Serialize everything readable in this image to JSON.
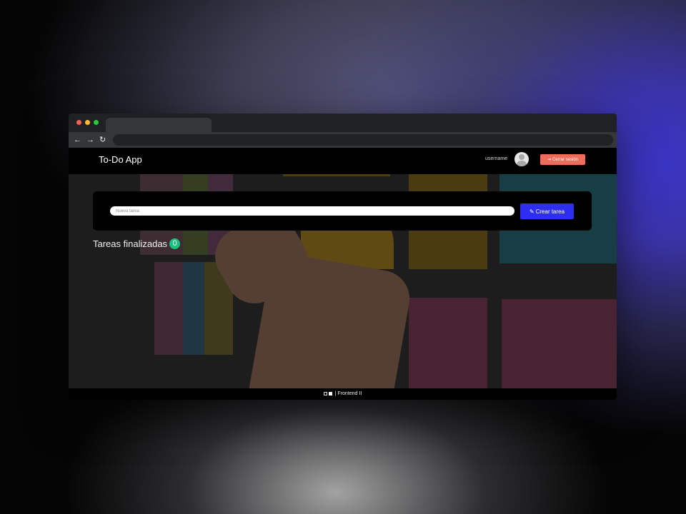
{
  "navbar": {
    "brand": "To-Do App",
    "username": "username",
    "logout_label": "Cerrar sesión"
  },
  "form": {
    "placeholder": "Nueva tarea",
    "button_label": "Crear tarea"
  },
  "tasks": {
    "done_title": "Tareas finalizadas",
    "done_count": "0"
  },
  "footer": {
    "text": "| Frontend II"
  },
  "icons": {
    "logout": "sign-out-icon",
    "create": "pencil-icon",
    "avatar": "user-avatar-icon"
  },
  "colors": {
    "logout_button": "#ef6c5a",
    "create_button": "#2e2ef0",
    "count_badge": "#19c37d",
    "navbar": "#000000"
  }
}
